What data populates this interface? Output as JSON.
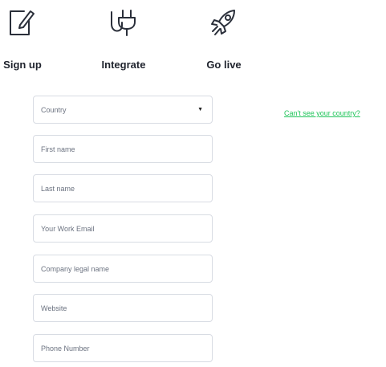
{
  "steps": [
    {
      "label": "Sign up",
      "icon": "document-edit-icon"
    },
    {
      "label": "Integrate",
      "icon": "plug-icon"
    },
    {
      "label": "Go live",
      "icon": "rocket-icon"
    }
  ],
  "form": {
    "country": {
      "value": "Country",
      "caret_icon": "caret-down-icon"
    },
    "first_name": {
      "placeholder": "First name",
      "value": ""
    },
    "last_name": {
      "placeholder": "Last name",
      "value": ""
    },
    "work_email": {
      "placeholder": "Your Work Email",
      "value": ""
    },
    "company_legal_name": {
      "placeholder": "Company legal name",
      "value": ""
    },
    "website": {
      "placeholder": "Website",
      "value": ""
    },
    "phone_number": {
      "placeholder": "Phone Number",
      "value": ""
    }
  },
  "links": {
    "cant_see_country": "Can't see your country?"
  },
  "colors": {
    "link": "#20c45a",
    "text": "#20242e",
    "border": "#d8dce3"
  }
}
